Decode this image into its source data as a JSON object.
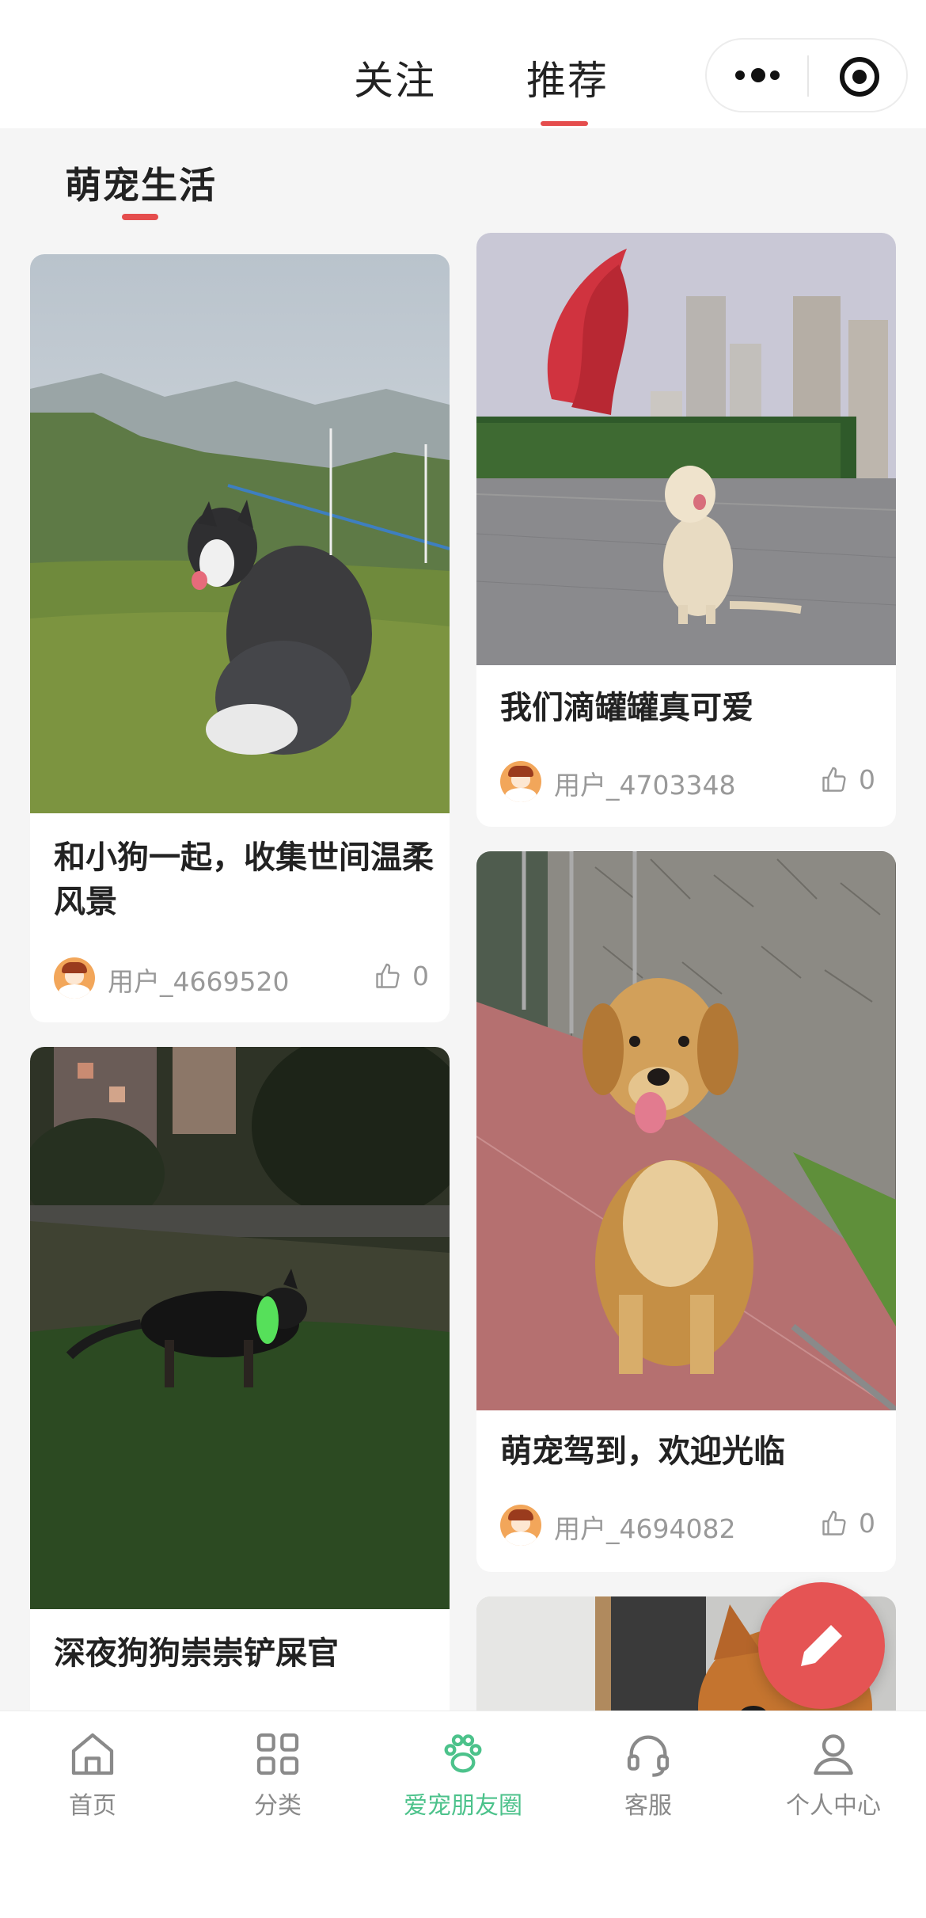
{
  "top_tabs": {
    "follow": "关注",
    "recommend": "推荐"
  },
  "section": {
    "title": "萌宠生活"
  },
  "cards": [
    {
      "title": "和小狗一起，收集世间温柔风景",
      "user": "用户_4669520",
      "likes": "0"
    },
    {
      "title": "我们滴罐罐真可爱",
      "user": "用户_4703348",
      "likes": "0"
    },
    {
      "title": "萌宠驾到，欢迎光临",
      "user": "用户_4694082",
      "likes": "0"
    },
    {
      "title": "深夜狗狗崇崇铲屎官"
    }
  ],
  "nav": [
    {
      "label": "首页",
      "icon": "home-icon"
    },
    {
      "label": "分类",
      "icon": "grid-icon"
    },
    {
      "label": "爱宠朋友圈",
      "icon": "paw-icon"
    },
    {
      "label": "客服",
      "icon": "headset-icon"
    },
    {
      "label": "个人中心",
      "icon": "person-icon"
    }
  ],
  "colors": {
    "accent": "#e54d4d",
    "active_nav": "#4cc28b",
    "muted": "#999999"
  }
}
